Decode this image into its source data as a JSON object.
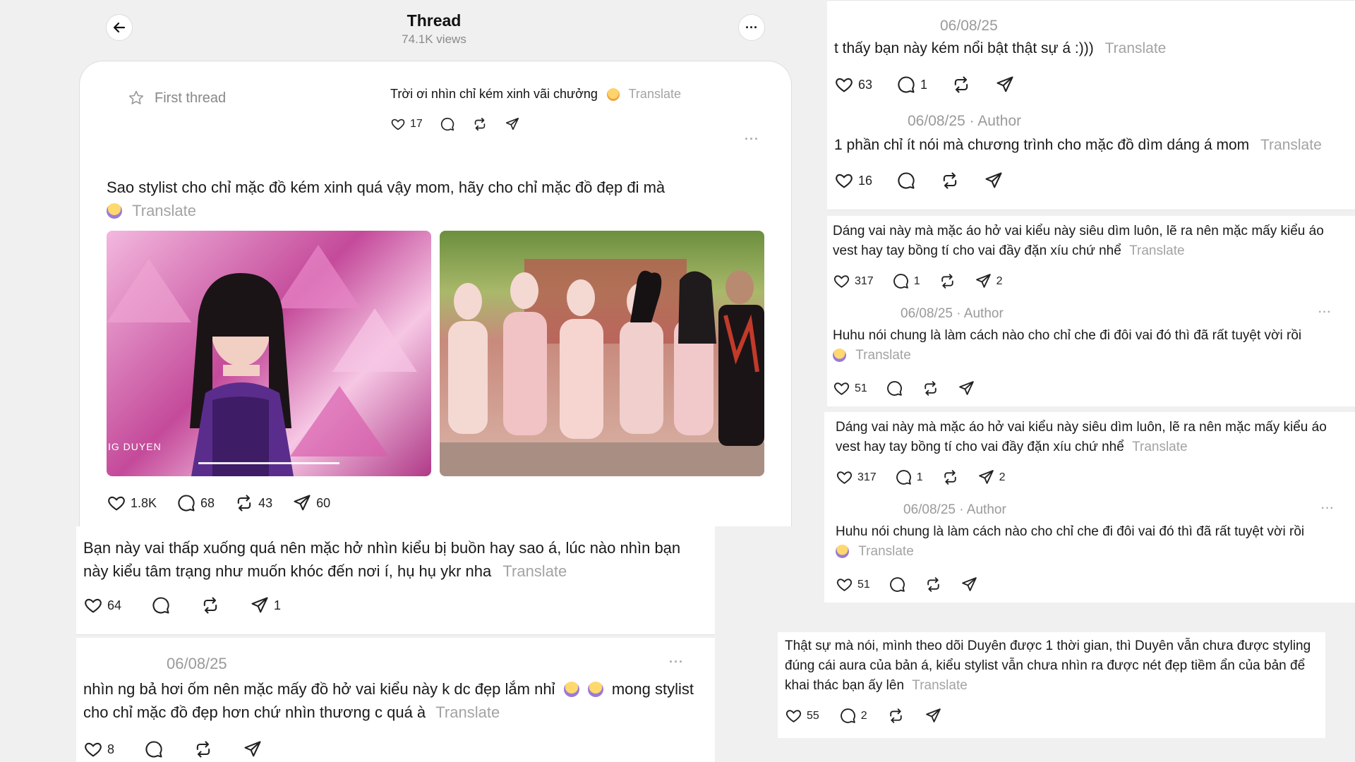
{
  "header": {
    "title": "Thread",
    "views": "74.1K views"
  },
  "first_thread": {
    "label": "First thread",
    "quote_text": "Trời ơi nhìn chỉ kém xinh vãi chưởng",
    "translate": "Translate",
    "likes": "17"
  },
  "main_post": {
    "text": "Sao stylist cho chỉ mặc đồ kém xinh quá vậy mom, hãy cho chỉ mặc đồ đẹp đi mà",
    "translate": "Translate",
    "image1_caption": "IG DUYEN",
    "likes": "1.8K",
    "comments": "68",
    "reposts": "43",
    "shares": "60"
  },
  "left_comments": [
    {
      "text": "Bạn này vai thấp xuống quá nên mặc hở nhìn kiểu bị buồn hay sao á, lúc nào nhìn bạn này kiểu tâm trạng như muốn khóc đến nơi í, hụ hụ ykr nha",
      "translate": "Translate",
      "likes": "64",
      "shares": "1"
    },
    {
      "date": "06/08/25",
      "text": "nhìn ng bả hơi ốm nên mặc mấy đồ hở vai kiểu này k dc đẹp lắm nhỉ",
      "text2": "mong stylist cho chỉ mặc đồ đẹp hơn chứ nhìn thương c quá à",
      "translate": "Translate",
      "likes": "8"
    }
  ],
  "right_comments": [
    {
      "date": "06/08/25",
      "text": "t thấy bạn này kém nổi bật thật sự á :)))",
      "translate": "Translate",
      "likes": "63",
      "comments": "1"
    },
    {
      "date": "06/08/25 · Author",
      "text": "1 phần chỉ ít nói mà chương trình cho mặc đồ dìm dáng á mom",
      "translate": "Translate",
      "likes": "16"
    },
    {
      "text": "Dáng vai này mà mặc áo hở vai kiểu này siêu dìm luôn, lẽ ra nên mặc mấy kiểu áo vest hay tay bồng tí cho vai đầy đặn xíu chứ nhể",
      "translate": "Translate",
      "likes": "317",
      "comments": "1",
      "shares": "2"
    },
    {
      "date": "06/08/25 · Author",
      "text": "Huhu nói chung là làm cách nào cho chỉ che đi đôi vai đó thì đã rất tuyệt vời rồi",
      "translate": "Translate",
      "likes": "51"
    },
    {
      "text": "Dáng vai này mà mặc áo hở vai kiểu này siêu dìm luôn, lẽ ra nên mặc mấy kiểu áo vest hay tay bồng tí cho vai đầy đặn xíu chứ nhể",
      "translate": "Translate",
      "likes": "317",
      "comments": "1",
      "shares": "2"
    },
    {
      "date": "06/08/25 · Author",
      "text": "Huhu nói chung là làm cách nào cho chỉ che đi đôi vai đó thì đã rất tuyệt vời rồi",
      "translate": "Translate",
      "likes": "51"
    },
    {
      "text": "Thật sự mà nói, mình theo dõi Duyên được 1 thời gian, thì Duyên vẫn chưa được styling đúng cái aura của bản á, kiểu stylist vẫn chưa nhìn ra được nét đẹp tiềm ẩn của bản để khai thác bạn ấy lên",
      "translate": "Translate",
      "likes": "55",
      "comments": "2"
    }
  ],
  "icons": [
    "back-arrow-icon",
    "more-icon",
    "star-icon",
    "heart-icon",
    "comment-icon",
    "repost-icon",
    "share-icon"
  ]
}
